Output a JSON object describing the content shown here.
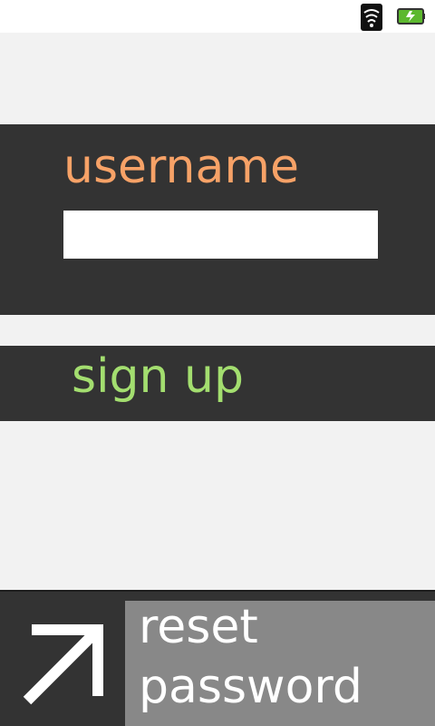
{
  "status_bar": {
    "wifi_icon": "wifi-icon",
    "battery_icon": "battery-charging-icon",
    "battery_color": "#5cb82e"
  },
  "login": {
    "username_label": "username",
    "username_value": "",
    "signup_label": "sign up"
  },
  "footer": {
    "arrow_icon": "arrow-up-right-icon",
    "reset_label": "reset\npassword"
  },
  "colors": {
    "background": "#f2f2f2",
    "panel": "#333333",
    "username_accent": "#f7a267",
    "signup_accent": "#a3de6f",
    "reset_panel": "#888888"
  }
}
